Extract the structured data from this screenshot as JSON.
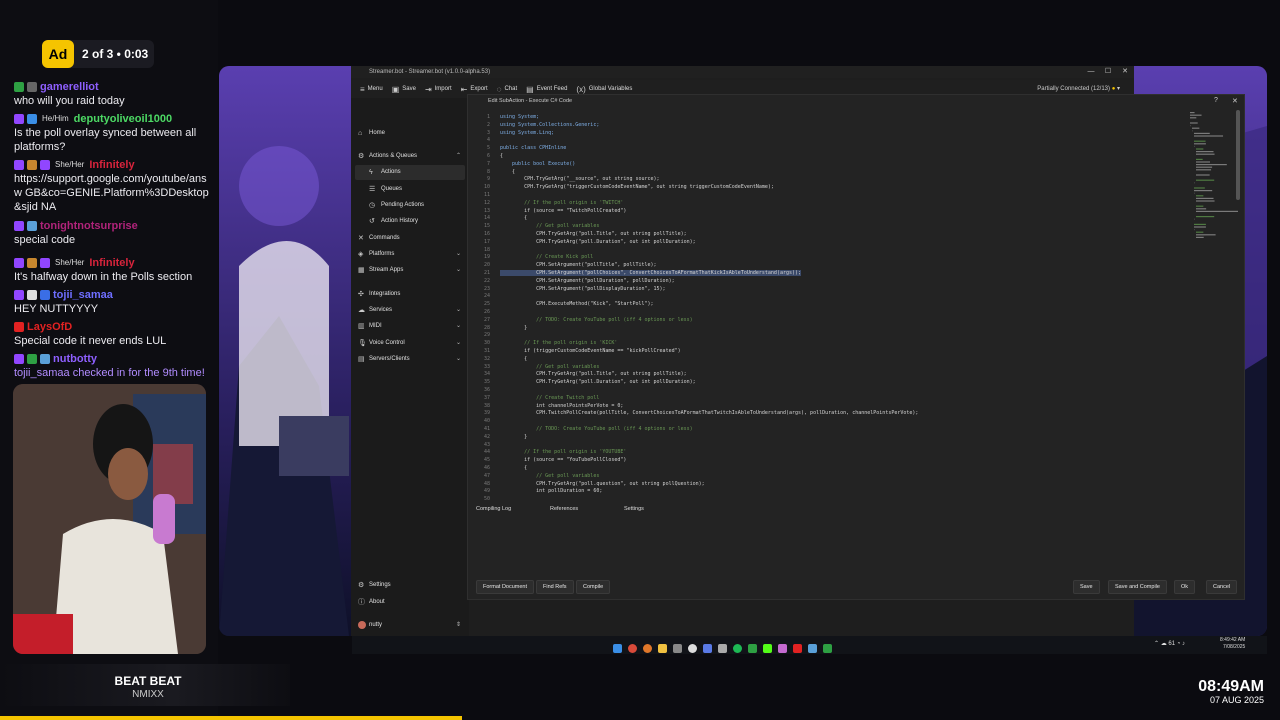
{
  "ad": {
    "label": "Ad",
    "progress": "2 of 3 • 0:03"
  },
  "chat": [
    {
      "user": "gamerelliot",
      "color": "#8e5fff",
      "text": "who will you raid today"
    },
    {
      "pronoun": "He/Him",
      "user": "deputyoliveoil1000",
      "color": "#4cd964",
      "text": "Is the poll overlay synced between all platforms?"
    },
    {
      "pronoun": "She/Her",
      "user": "Infinitely",
      "color": "#d8243c",
      "text": "https://support.google.com/youtube/answ GB&co=GENIE.Platform%3DDesktop&sjid NA"
    },
    {
      "user": "tonightnotsurprise",
      "color": "#b0237a",
      "text": "special code"
    },
    {
      "pronoun": "She/Her",
      "user": "Infinitely",
      "color": "#d8243c",
      "text": "It's halfway down in the Polls section"
    },
    {
      "user": "tojii_samaa",
      "color": "#6e6eff",
      "text": "HEY NUTTYYYY"
    },
    {
      "user": "LaysOfD",
      "color": "#e22222",
      "text": "Special code it never ends LUL"
    },
    {
      "user": "nutbotty",
      "color": "#8e5fff",
      "text": "tojii_samaa checked in for the 9th time!"
    }
  ],
  "song": {
    "title": "BEAT BEAT",
    "artist": "NMIXX"
  },
  "clock": {
    "time": "08:49AM",
    "date": "07 AUG 2025"
  },
  "app": {
    "title": "Streamer.bot - Streamer.bot (v1.0.0-alpha.53)",
    "menu": [
      "Menu",
      "Save",
      "Import",
      "Export",
      "Chat",
      "Event Feed",
      "Global Variables"
    ],
    "status": "Partially Connected (12/13)",
    "sidebar": {
      "home": "Home",
      "actions_queues": "Actions & Queues",
      "actions": "Actions",
      "queues": "Queues",
      "pending": "Pending Actions",
      "history": "Action History",
      "commands": "Commands",
      "platforms": "Platforms",
      "stream_apps": "Stream Apps",
      "integrations": "Integrations",
      "services": "Services",
      "midi": "MIDI",
      "voice": "Voice Control",
      "servers": "Servers/Clients",
      "settings": "Settings",
      "about": "About",
      "user": "nutty"
    }
  },
  "editor": {
    "title": "Edit SubAction - Execute C# Code",
    "tabs": [
      "Compiling Log",
      "References",
      "Settings"
    ],
    "buttons": {
      "format": "Format Document",
      "find": "Find Refs",
      "compile": "Compile",
      "save": "Save",
      "save_compile": "Save and Compile",
      "ok": "Ok",
      "cancel": "Cancel"
    },
    "highlight_line": 21,
    "lines": [
      "using System;",
      "using System.Collections.Generic;",
      "using System.Linq;",
      "",
      "public class CPHInline",
      "{",
      "    public bool Execute()",
      "    {",
      "        CPH.TryGetArg(\"__source\", out string source);",
      "        CPH.TryGetArg(\"triggerCustomCodeEventName\", out string triggerCustomCodeEventName);",
      "",
      "        // If the poll origin is 'TWITCH'",
      "        if (source == \"TwitchPollCreated\")",
      "        {",
      "            // Get poll variables",
      "            CPH.TryGetArg(\"poll.Title\", out string pollTitle);",
      "            CPH.TryGetArg(\"poll.Duration\", out int pollDuration);",
      "",
      "            // Create Kick poll",
      "            CPH.SetArgument(\"pollTitle\", pollTitle);",
      "            CPH.SetArgument(\"pollChoices\", ConvertChoicesToAFormatThatKickIsAbleToUnderstand(args));",
      "            CPH.SetArgument(\"pollDuration\", pollDuration);",
      "            CPH.SetArgument(\"pollDisplayDuration\", 15);",
      "",
      "            CPH.ExecuteMethod(\"Kick\", \"StartPoll\");",
      "",
      "            // TODO: Create YouTube poll (iff 4 options or less)",
      "        }",
      "",
      "        // If the poll origin is 'KICK'",
      "        if (triggerCustomCodeEventName == \"kickPollCreated\")",
      "        {",
      "            // Get poll variables",
      "            CPH.TryGetArg(\"poll.Title\", out string pollTitle);",
      "            CPH.TryGetArg(\"poll.Duration\", out int pollDuration);",
      "",
      "            // Create Twitch poll",
      "            int channelPointsPerVote = 0;",
      "            CPH.TwitchPollCreate(pollTitle, ConvertChoicesToAFormatThatTwitchIsAbleToUnderstand(args), pollDuration, channelPointsPerVote);",
      "",
      "            // TODO: Create YouTube poll (iff 4 options or less)",
      "        }",
      "",
      "        // If the poll origin is 'YOUTUBE'",
      "        if (source == \"YouTubePollClosed\")",
      "        {",
      "            // Get poll variables",
      "            CPH.TryGetArg(\"poll.question\", out string pollQuestion);",
      "            int pollDuration = 60;",
      "            "
    ]
  },
  "tray": {
    "temp": "61",
    "time": "8:49:42 AM",
    "date": "7/08/2025"
  }
}
